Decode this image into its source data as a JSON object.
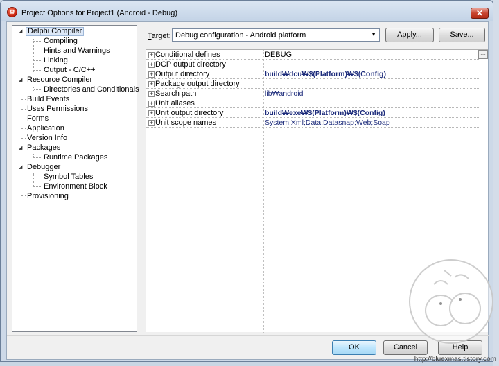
{
  "window": {
    "title": "Project Options for Project1  (Android - Debug)",
    "icon": "delphi-app-icon",
    "close_glyph": "✕",
    "close_label": "close-icon"
  },
  "tree": {
    "items": [
      {
        "label": "Delphi Compiler"
      },
      {
        "label": "Compiling"
      },
      {
        "label": "Hints and Warnings"
      },
      {
        "label": "Linking"
      },
      {
        "label": "Output - C/C++"
      },
      {
        "label": "Resource Compiler"
      },
      {
        "label": "Directories and Conditionals"
      },
      {
        "label": "Build Events"
      },
      {
        "label": "Uses Permissions"
      },
      {
        "label": "Forms"
      },
      {
        "label": "Application"
      },
      {
        "label": "Version Info"
      },
      {
        "label": "Packages"
      },
      {
        "label": "Runtime Packages"
      },
      {
        "label": "Debugger"
      },
      {
        "label": "Symbol Tables"
      },
      {
        "label": "Environment Block"
      },
      {
        "label": "Provisioning"
      }
    ],
    "expand_glyph": "◢"
  },
  "target": {
    "label_first": "T",
    "label_rest": "arget:",
    "selected": "Debug configuration - Android platform",
    "arrow": "▼"
  },
  "toolbar": {
    "apply_label": "Apply...",
    "save_label": "Save..."
  },
  "properties": [
    {
      "name": "Conditional defines",
      "value": "DEBUG"
    },
    {
      "name": "DCP output directory",
      "value": ""
    },
    {
      "name": "Output directory",
      "value": "build₩dcu₩$(Platform)₩$(Config)"
    },
    {
      "name": "Package output directory",
      "value": ""
    },
    {
      "name": "Search path",
      "value": "lib₩android"
    },
    {
      "name": "Unit aliases",
      "value": ""
    },
    {
      "name": "Unit output directory",
      "value": "build₩exe₩$(Platform)₩$(Config)"
    },
    {
      "name": "Unit scope names",
      "value": "System;Xml;Data;Datasnap;Web;Soap"
    }
  ],
  "expander_glyph": "+",
  "ellipsis": "...",
  "buttons": {
    "ok": "OK",
    "cancel": "Cancel",
    "help": "Help"
  },
  "footer": {
    "url": "http://bluexmas.tistory.com"
  }
}
